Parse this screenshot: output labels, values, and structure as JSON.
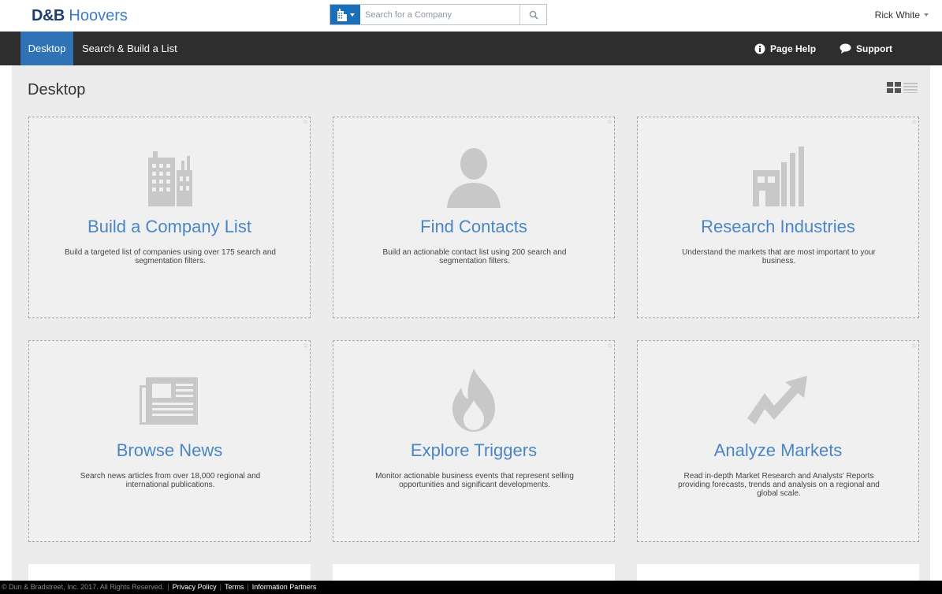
{
  "header": {
    "logo_brand": "D&B",
    "logo_name": "Hoovers",
    "search_placeholder": "Search for a Company",
    "user_name": "Rick White"
  },
  "nav": {
    "tabs": [
      {
        "label": "Desktop",
        "active": true
      },
      {
        "label": "Search & Build a List",
        "active": false
      }
    ],
    "page_help": "Page Help",
    "support": "Support"
  },
  "page": {
    "title": "Desktop"
  },
  "cards": [
    {
      "icon": "building-icon",
      "title": "Build a Company List",
      "description": "Build a targeted list of companies using over 175 search and segmentation filters."
    },
    {
      "icon": "person-icon",
      "title": "Find Contacts",
      "description": "Build an actionable contact list using 200 search and segmentation filters."
    },
    {
      "icon": "factory-icon",
      "title": "Research Industries",
      "description": "Understand the markets that are most important to your business."
    },
    {
      "icon": "newspaper-icon",
      "title": "Browse News",
      "description": "Search news articles from over 18,000 regional and international publications."
    },
    {
      "icon": "flame-icon",
      "title": "Explore Triggers",
      "description": "Monitor actionable business events that represent selling opportunities and significant developments."
    },
    {
      "icon": "trend-arrow-icon",
      "title": "Analyze Markets",
      "description": "Read in-depth Market Research and Analysts' Reports providing forecasts, trends and analysis on a regional and global scale."
    }
  ],
  "footer": {
    "copyright": "© Dun & Bradstreet, Inc. 2017. All Rights Reserved.",
    "privacy": "Privacy Policy",
    "terms": "Terms",
    "info_partners": "Information Partners"
  },
  "colors": {
    "nav_bg": "#2e2e2e",
    "active_tab": "#2f72b5",
    "card_title": "#4a86c6",
    "icon_gray": "#c6c6c6"
  }
}
